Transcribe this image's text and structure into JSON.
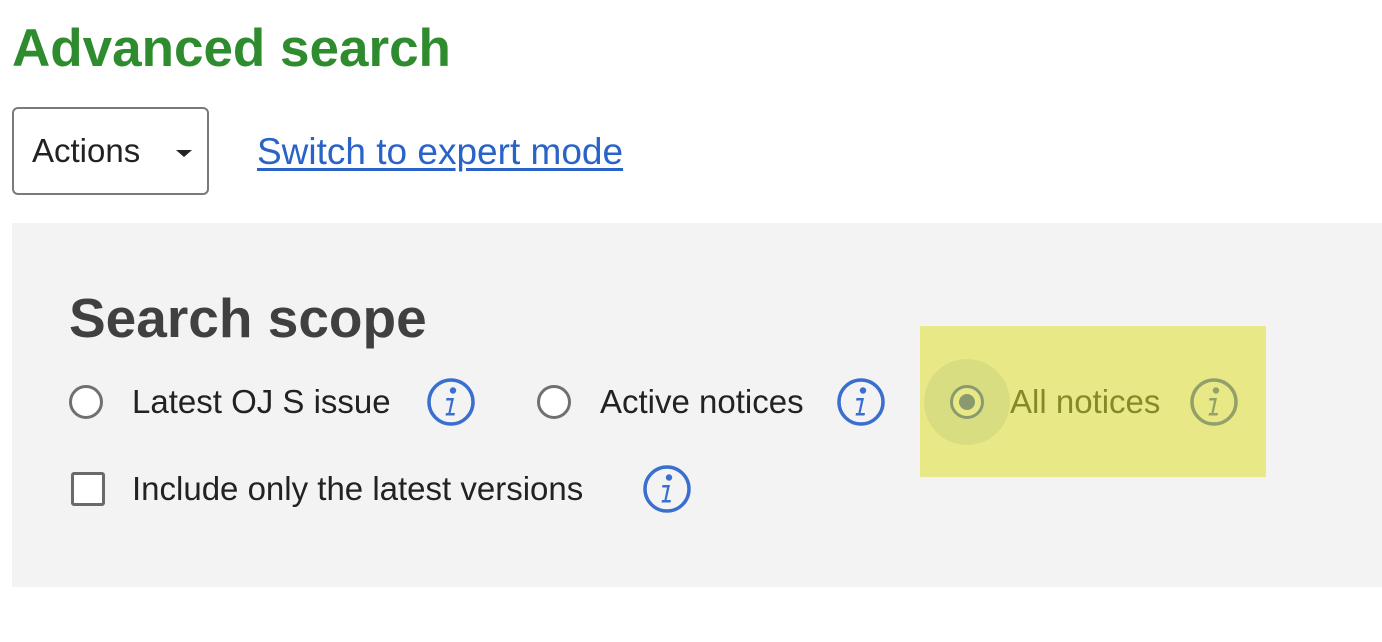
{
  "page": {
    "title": "Advanced search"
  },
  "toolbar": {
    "actions_label": "Actions",
    "expert_mode_link": "Switch to expert mode"
  },
  "search_scope": {
    "title": "Search scope",
    "options": [
      {
        "label": "Latest OJ S issue",
        "selected": false
      },
      {
        "label": "Active notices",
        "selected": false
      },
      {
        "label": "All notices",
        "selected": true
      }
    ],
    "latest_versions_checkbox": {
      "label": "Include only the latest versions",
      "checked": false
    }
  },
  "icons": {
    "info": "info-icon",
    "dropdown": "caret-down-icon"
  },
  "colors": {
    "title_green": "#2e8b2e",
    "link_blue": "#2a63c8",
    "info_blue": "#3a6fd0",
    "highlight_yellow": "#e8e986",
    "panel_gray": "#f3f3f3"
  }
}
